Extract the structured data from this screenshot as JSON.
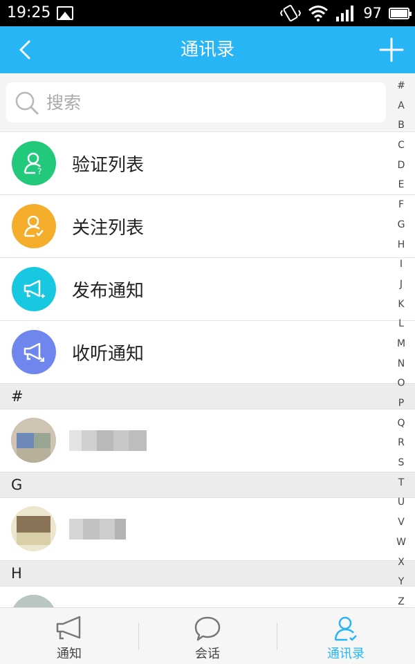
{
  "status": {
    "time": "19:25",
    "battery": "97"
  },
  "header": {
    "title": "通讯录"
  },
  "search": {
    "placeholder": "搜索"
  },
  "functions": [
    {
      "label": "验证列表",
      "color": "#22c97b"
    },
    {
      "label": "关注列表",
      "color": "#f5ad2c"
    },
    {
      "label": "发布通知",
      "color": "#18c7e0"
    },
    {
      "label": "收听通知",
      "color": "#6f86ee"
    }
  ],
  "sections": [
    {
      "letter": "#"
    },
    {
      "letter": "G"
    },
    {
      "letter": "H"
    }
  ],
  "alphabet": [
    "#",
    "A",
    "B",
    "C",
    "D",
    "E",
    "F",
    "G",
    "H",
    "I",
    "J",
    "K",
    "L",
    "M",
    "N",
    "O",
    "P",
    "Q",
    "R",
    "S",
    "T",
    "U",
    "V",
    "W",
    "X",
    "Y",
    "Z"
  ],
  "tabs": [
    {
      "label": "通知",
      "active": false
    },
    {
      "label": "会话",
      "active": false
    },
    {
      "label": "通讯录",
      "active": true
    }
  ],
  "colors": {
    "accent": "#28b5f5"
  }
}
